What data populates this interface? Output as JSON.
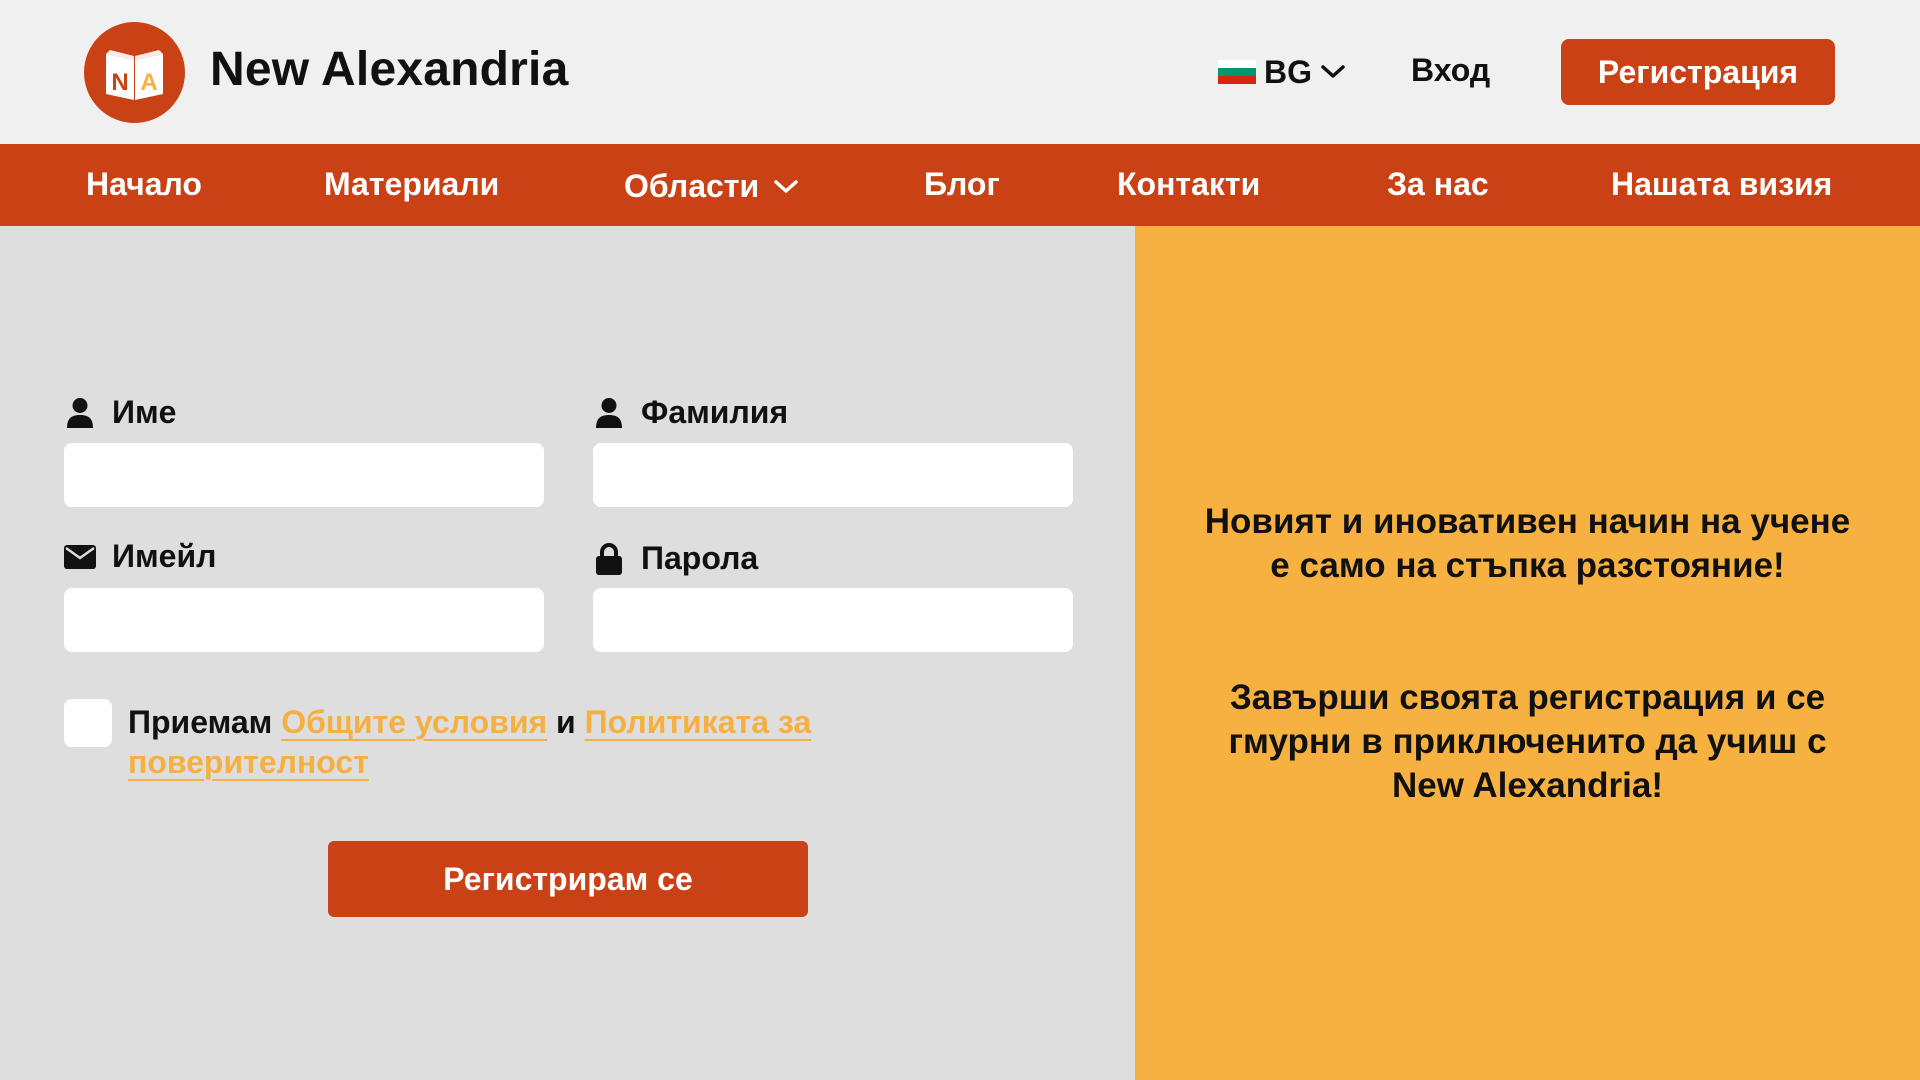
{
  "header": {
    "brand": "New Alexandria",
    "logo_letters": [
      "N",
      "A"
    ],
    "language": "BG",
    "login": "Вход",
    "register": "Регистрация"
  },
  "nav": {
    "items": [
      {
        "label": "Начало"
      },
      {
        "label": "Материали"
      },
      {
        "label": "Области",
        "dropdown": true
      },
      {
        "label": "Блог"
      },
      {
        "label": "Контакти"
      },
      {
        "label": "За нас"
      },
      {
        "label": "Нашата визия"
      }
    ]
  },
  "form": {
    "first_name": {
      "label": "Име",
      "value": "",
      "icon": "user-icon"
    },
    "last_name": {
      "label": "Фамилия",
      "value": "",
      "icon": "user-icon"
    },
    "email": {
      "label": "Имейл",
      "value": "",
      "icon": "envelope-icon"
    },
    "password": {
      "label": "Парола",
      "value": "",
      "icon": "lock-icon"
    },
    "terms": {
      "prefix": "Приемам",
      "terms_link": "Общите условия",
      "conjunction": "и",
      "privacy_link": "Политиката за поверителност",
      "checked": false
    },
    "submit": "Регистрирам се"
  },
  "promo": {
    "line1": "Новият и иновативен начин на учене е само на стъпка разстояние!",
    "line2": "Завърши своята регистрация и се гмурни в приключенито да учиш с New Alexandria!"
  },
  "colors": {
    "primary": "#c94114",
    "accent": "#f6b141",
    "link": "#f5b041",
    "header_bg": "#f0f0f0",
    "form_bg": "#dedede",
    "flag": [
      "#ffffff",
      "#00966e",
      "#d62612"
    ]
  }
}
